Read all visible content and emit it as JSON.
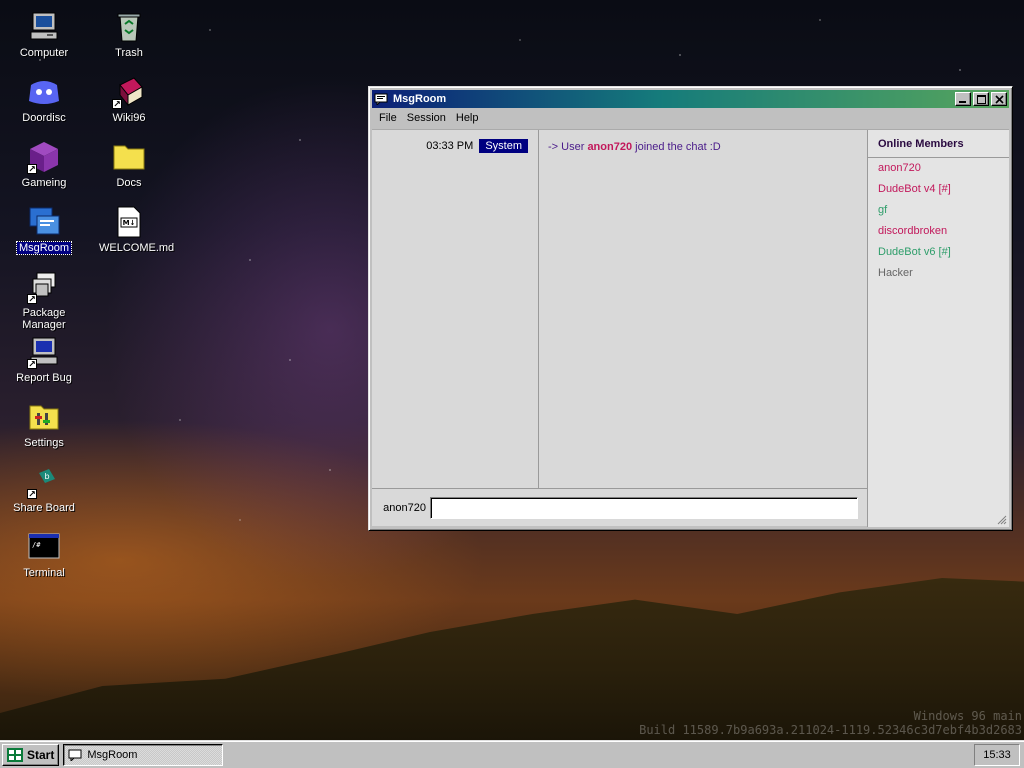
{
  "desktop": {
    "icons": [
      {
        "label": "Computer"
      },
      {
        "label": "Trash"
      },
      {
        "label": "Doordisc"
      },
      {
        "label": "Wiki96"
      },
      {
        "label": "Gameing"
      },
      {
        "label": "Docs"
      },
      {
        "label": "MsgRoom"
      },
      {
        "label": "WELCOME.md"
      },
      {
        "label": "Package Manager"
      },
      {
        "label": "Report Bug"
      },
      {
        "label": "Settings"
      },
      {
        "label": "Share Board"
      },
      {
        "label": "Terminal"
      }
    ]
  },
  "window": {
    "title": "MsgRoom",
    "menu": [
      "File",
      "Session",
      "Help"
    ],
    "messages": [
      {
        "time": "03:33 PM",
        "sender": "System",
        "prefix": "-> User",
        "user": "anon720",
        "suffix": "joined the chat :D"
      }
    ],
    "members_title": "Online Members",
    "members": [
      {
        "name": "anon720",
        "color": "#c2185b"
      },
      {
        "name": "DudeBot v4 [#]",
        "color": "#c2185b"
      },
      {
        "name": "gf",
        "color": "#2e9d6a"
      },
      {
        "name": "discordbroken",
        "color": "#c2185b"
      },
      {
        "name": "DudeBot v6 [#]",
        "color": "#2e9d6a"
      },
      {
        "name": "Hacker",
        "color": "#666666"
      }
    ],
    "input_label": "anon720",
    "input_value": ""
  },
  "watermark": {
    "line1": "Windows 96 main",
    "line2": "Build 11589.7b9a693a.211024-1119.52346c3d7ebf4b3d2683"
  },
  "taskbar": {
    "start_label": "Start",
    "task_label": "MsgRoom",
    "clock": "15:33"
  }
}
